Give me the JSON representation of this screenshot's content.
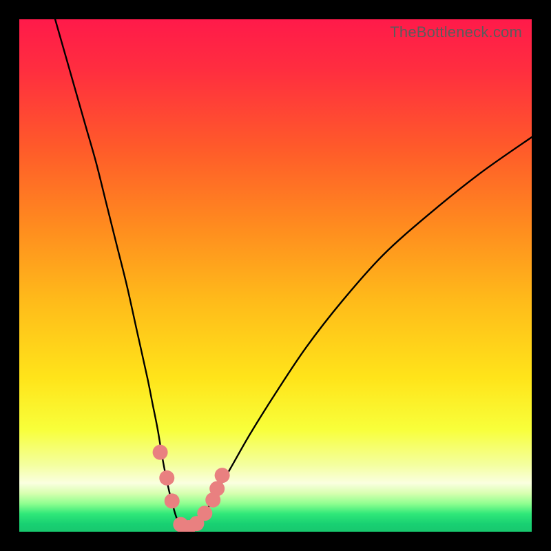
{
  "watermark": {
    "text": "TheBottleneck.com"
  },
  "colors": {
    "frame": "#000000",
    "curve": "#000000",
    "markers": "#e98080",
    "gradient_stops": [
      {
        "offset": 0.0,
        "color": "#ff1a4a"
      },
      {
        "offset": 0.1,
        "color": "#ff2e3f"
      },
      {
        "offset": 0.25,
        "color": "#ff5a2a"
      },
      {
        "offset": 0.4,
        "color": "#ff8a1f"
      },
      {
        "offset": 0.55,
        "color": "#ffbb1a"
      },
      {
        "offset": 0.7,
        "color": "#ffe41a"
      },
      {
        "offset": 0.8,
        "color": "#f8ff3a"
      },
      {
        "offset": 0.87,
        "color": "#f4ffa0"
      },
      {
        "offset": 0.905,
        "color": "#faffe0"
      },
      {
        "offset": 0.925,
        "color": "#d8ffb0"
      },
      {
        "offset": 0.945,
        "color": "#90ff90"
      },
      {
        "offset": 0.965,
        "color": "#30e879"
      },
      {
        "offset": 0.985,
        "color": "#18d072"
      },
      {
        "offset": 1.0,
        "color": "#18c86e"
      }
    ]
  },
  "chart_data": {
    "type": "line",
    "title": "",
    "xlabel": "",
    "ylabel": "",
    "xlim": [
      0,
      100
    ],
    "ylim": [
      0,
      100
    ],
    "grid": false,
    "series": [
      {
        "name": "bottleneck-curve",
        "x": [
          7,
          9,
          11,
          13,
          15,
          17,
          19,
          21,
          23,
          25,
          26,
          27,
          28,
          29,
          30,
          31,
          32.5,
          34,
          36,
          38,
          41,
          45,
          50,
          56,
          63,
          71,
          80,
          90,
          100
        ],
        "values": [
          100,
          93,
          86,
          79,
          72,
          64,
          56,
          48,
          39,
          30,
          25,
          20,
          14,
          9,
          5,
          2,
          0.5,
          1,
          3,
          7,
          12,
          19,
          27,
          36,
          45,
          54,
          62,
          70,
          77
        ]
      }
    ],
    "markers": [
      {
        "x": 27.5,
        "y": 15.5
      },
      {
        "x": 28.8,
        "y": 10.5
      },
      {
        "x": 29.8,
        "y": 6.0
      },
      {
        "x": 31.5,
        "y": 1.4
      },
      {
        "x": 33.0,
        "y": 0.8
      },
      {
        "x": 34.6,
        "y": 1.6
      },
      {
        "x": 36.2,
        "y": 3.6
      },
      {
        "x": 37.8,
        "y": 6.2
      },
      {
        "x": 38.6,
        "y": 8.4
      },
      {
        "x": 39.6,
        "y": 11.0
      }
    ],
    "curve_min": {
      "x": 32.5,
      "y": 0.5
    }
  }
}
